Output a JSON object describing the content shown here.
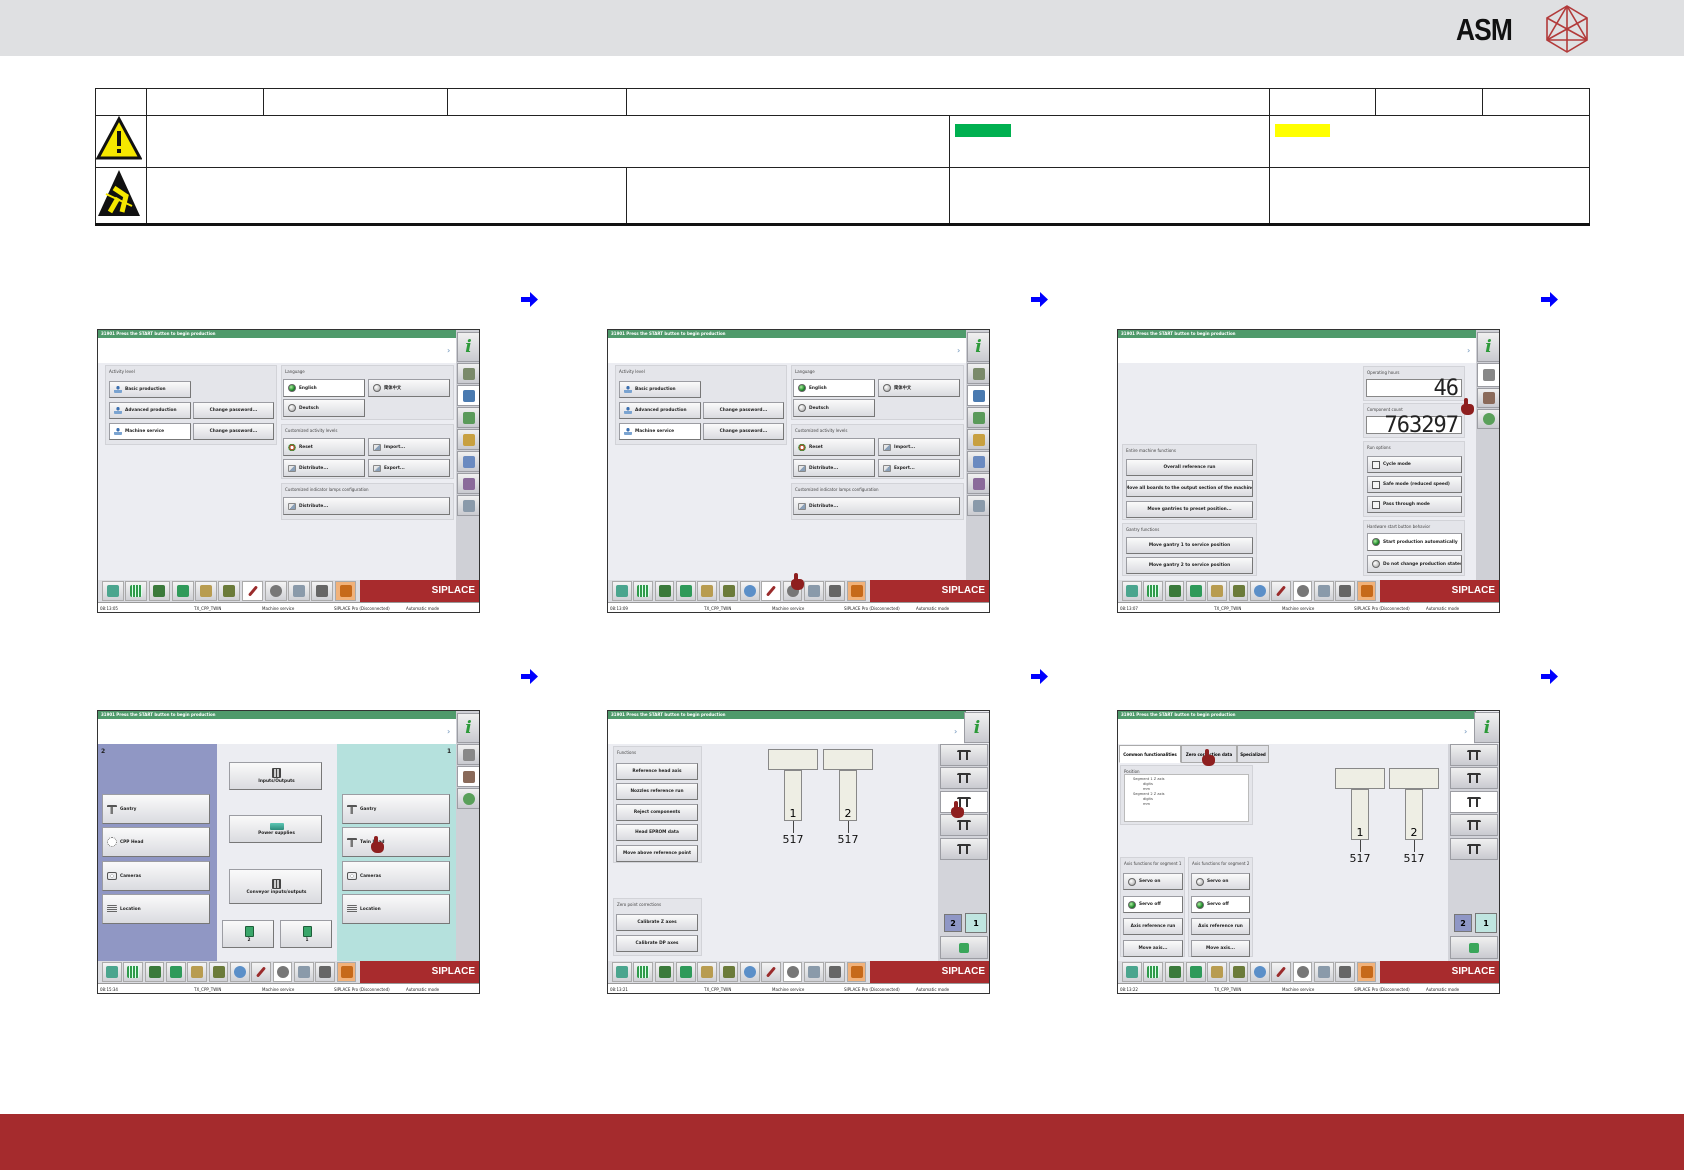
{
  "header": {
    "logo_text": "ASM"
  },
  "colors": {
    "top_band": "#dfe0e2",
    "bottom_band": "#a52b2d",
    "status_green": "#00b050",
    "status_yellow": "#ffff00",
    "arrow": "#0000ff",
    "siplace_red": "#a82b2d"
  },
  "common": {
    "status_message": "31901 Press the START button to begin production",
    "brand": "SIPLACE",
    "line_name": "TX_CPP_TWIN",
    "activity": "Machine service",
    "siplace_pro": "SIPLACE Pro (Disconnected)",
    "mode": "Automatic mode"
  },
  "screens": [
    {
      "clock": "08:13:05",
      "panels": [
        {
          "title": "Activity level",
          "buttons": [
            "Basic production",
            "Advanced production",
            "Change password...",
            "Machine service",
            "Change password..."
          ]
        },
        {
          "title": "Language",
          "buttons": [
            "English",
            "简体中文",
            "Deutsch"
          ]
        },
        {
          "title": "Customized activity levels",
          "buttons": [
            "Reset",
            "Import...",
            "Distribute...",
            "Export..."
          ]
        },
        {
          "title": "Customized indicator lamps configuration",
          "buttons": [
            "Distribute..."
          ]
        }
      ]
    },
    {
      "clock": "08:13:09",
      "panels": [
        {
          "title": "Activity level",
          "buttons": [
            "Basic production",
            "Advanced production",
            "Change password...",
            "Machine service",
            "Change password..."
          ]
        },
        {
          "title": "Language",
          "buttons": [
            "English",
            "简体中文",
            "Deutsch"
          ]
        },
        {
          "title": "Customized activity levels",
          "buttons": [
            "Reset",
            "Import...",
            "Distribute...",
            "Export..."
          ]
        },
        {
          "title": "Customized indicator lamps configuration",
          "buttons": [
            "Distribute..."
          ]
        }
      ]
    },
    {
      "clock": "08:13:07",
      "panels": [
        {
          "title": "Operating hours",
          "value": "46",
          "buttons": []
        },
        {
          "title": "Component count",
          "value": "763297",
          "buttons": []
        },
        {
          "title": "Run options",
          "buttons": [
            "Cycle mode",
            "Safe mode (reduced speed)",
            "Pass through mode"
          ]
        },
        {
          "title": "Hardware start button behavior",
          "buttons": [
            "Start production automatically",
            "Do not change production states"
          ]
        },
        {
          "title": "Entire machine functions",
          "buttons": [
            "Overall reference run",
            "Move all boards to the output section of the machine",
            "Move gantries to preset position..."
          ]
        },
        {
          "title": "Gantry functions",
          "buttons": [
            "Move gantry 1 to service position",
            "Move gantry 2 to service position"
          ]
        }
      ]
    },
    {
      "clock": "08:15:34",
      "regions": [
        {
          "label": "2",
          "buttons": [
            "Gantry",
            "CPP Head",
            "Cameras",
            "Location"
          ]
        },
        {
          "label": "1",
          "buttons": [
            "Gantry",
            "Twin head",
            "Cameras",
            "Location"
          ]
        }
      ],
      "middle_buttons": [
        "Inputs/Outputs",
        "Power supplies",
        "Conveyor inputs/outputs",
        "2",
        "1"
      ]
    },
    {
      "clock": "08:13:21",
      "panels": [
        {
          "title": "Functions",
          "buttons": [
            "Reference head axis",
            "Nozzles reference run",
            "Reject components",
            "Head EPROM data",
            "Move above reference point"
          ]
        },
        {
          "title": "Zero point corrections",
          "buttons": [
            "Calibrate Z axes",
            "Calibrate DP axes"
          ]
        }
      ],
      "heads": [
        {
          "number": "1",
          "value": "517"
        },
        {
          "number": "2",
          "value": "517"
        }
      ],
      "segments": [
        "2",
        "1"
      ]
    },
    {
      "clock": "08:13:22",
      "tabs": [
        "Common functionalities",
        "Zero correction data",
        "Specialized"
      ],
      "position_panel": {
        "title": "Position",
        "tree": [
          "Segment 1 Z axis",
          "digits",
          "mm",
          "Segment 2 Z axis",
          "digits",
          "mm"
        ]
      },
      "panels": [
        {
          "title": "Axis functions for segment 1",
          "buttons": [
            "Servo on",
            "Servo off",
            "Axis reference run",
            "Move axis..."
          ]
        },
        {
          "title": "Axis functions for segment 2",
          "buttons": [
            "Servo on",
            "Servo off",
            "Axis reference run",
            "Move axis..."
          ]
        }
      ],
      "heads": [
        {
          "number": "1",
          "value": "517"
        },
        {
          "number": "2",
          "value": "517"
        }
      ],
      "segments": [
        "2",
        "1"
      ]
    }
  ]
}
